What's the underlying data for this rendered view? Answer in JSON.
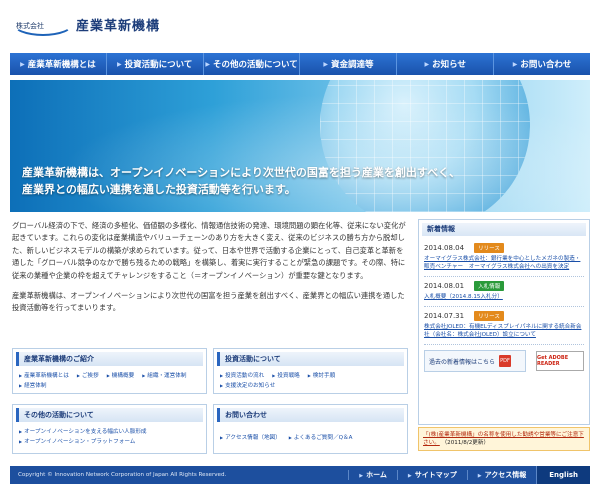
{
  "header": {
    "corp_prefix": "株式会社",
    "company_name": "産業革新機構"
  },
  "nav": {
    "items": [
      {
        "label": "産業革新機構とは"
      },
      {
        "label": "投資活動について"
      },
      {
        "label": "その他の活動について"
      },
      {
        "label": "資金調達等"
      },
      {
        "label": "お知らせ"
      },
      {
        "label": "お問い合わせ"
      }
    ]
  },
  "hero": {
    "line1": "産業革新機構は、オープンイノベーションにより次世代の国富を担う産業を創出すべく、",
    "line2": "産業界との幅広い連携を通した投資活動等を行います。"
  },
  "main": {
    "paragraph1": "グローバル経済の下で、経済の多極化、価値観の多様化、情報通信技術の発達、環境問題の顕在化等、従来にない変化が起きています。これらの変化は産業構造やバリューチェーンのあり方を大きく変え、従来のビジネスの勝ち方から脱却した、新しいビジネスモデルの構築が求められています。従って、日本や世界で活動する企業にとって、自己変革と革新を通した「グローバル競争のなかで勝ち残るための戦略」を構築し、着実に実行することが緊急の課題です。その際、特に従来の業種や企業の枠を超えてチャレンジをすること（＝オープンイノベーション）が重要な鍵となります。",
    "paragraph2": "産業革新機構は、オープンイノベーションにより次世代の国富を担う産業を創出すべく、産業界との幅広い連携を通した投資活動等を行ってまいります。"
  },
  "boxes": {
    "intro": {
      "title": "産業革新機構のご紹介",
      "links": [
        "産業革新機構とは",
        "ご挨拶",
        "機構概要",
        "組織・運営体制",
        "経営体制"
      ]
    },
    "invest": {
      "title": "投資活動について",
      "links": [
        "投資活動の流れ",
        "投資戦略",
        "検討手順",
        "支援決定のお知らせ"
      ]
    },
    "other": {
      "title": "その他の活動について",
      "links": [
        "オープンイノベーションを支える幅広い人脈形成",
        "オープンイノベーション・プラットフォーム"
      ]
    },
    "contact": {
      "title": "お問い合わせ",
      "links": [
        "アクセス情報（地図）",
        "よくあるご質問／Q＆A"
      ]
    }
  },
  "news": {
    "title": "新着情報",
    "items": [
      {
        "date": "2014.08.04",
        "badge": "リリース",
        "badge_type": "release",
        "text": "オーマイグラス株式会社：銀行業を中心としたメガネの製造・販売ベンチャー　オーマイグラス株式会社への出資を決定"
      },
      {
        "date": "2014.08.01",
        "badge": "入札情報",
        "badge_type": "invest",
        "text": "入札概要（2014.8.15入札分）"
      },
      {
        "date": "2014.07.31",
        "badge": "リリース",
        "badge_type": "release",
        "text": "株式会社JOLED：有機ELディスプレイパネルに関する統合新会社（会社名：株式会社JOLED）設立について"
      }
    ],
    "past_label": "過去の新着情報はこちら",
    "pdf_label": "PDF",
    "reader_label": "Get ADOBE READER"
  },
  "notice": {
    "highlight": "「(株)産業革新機構」の名称を使用した勧誘や営業等にご注意下さい。",
    "date": "（2011/8/2更新）"
  },
  "footer": {
    "copyright": "Copyright © Innovation Network Corporation of Japan All Rights Reserved.",
    "links": [
      "ホーム",
      "サイトマップ",
      "アクセス情報"
    ],
    "english": "English"
  }
}
